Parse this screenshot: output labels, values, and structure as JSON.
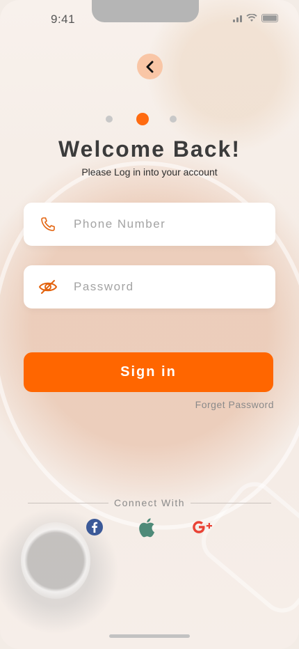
{
  "status_bar": {
    "time": "9:41"
  },
  "login": {
    "title": "Welcome Back!",
    "subtitle": "Please Log in into your account",
    "phone_placeholder": "Phone Number",
    "password_placeholder": "Password",
    "signin_label": "Sign in",
    "forget_label": "Forget Password",
    "connect_label": "Connect With"
  },
  "pager": {
    "count": 3,
    "active_index": 1
  },
  "social": [
    {
      "name": "facebook-icon",
      "color": "#3b5998"
    },
    {
      "name": "apple-icon",
      "color": "#4e8a78"
    },
    {
      "name": "google-plus-icon",
      "color": "#e94235"
    }
  ],
  "colors": {
    "accent": "#ff6600",
    "back_button_bg": "#f9c6a6",
    "title_text": "#3b3b3b"
  }
}
